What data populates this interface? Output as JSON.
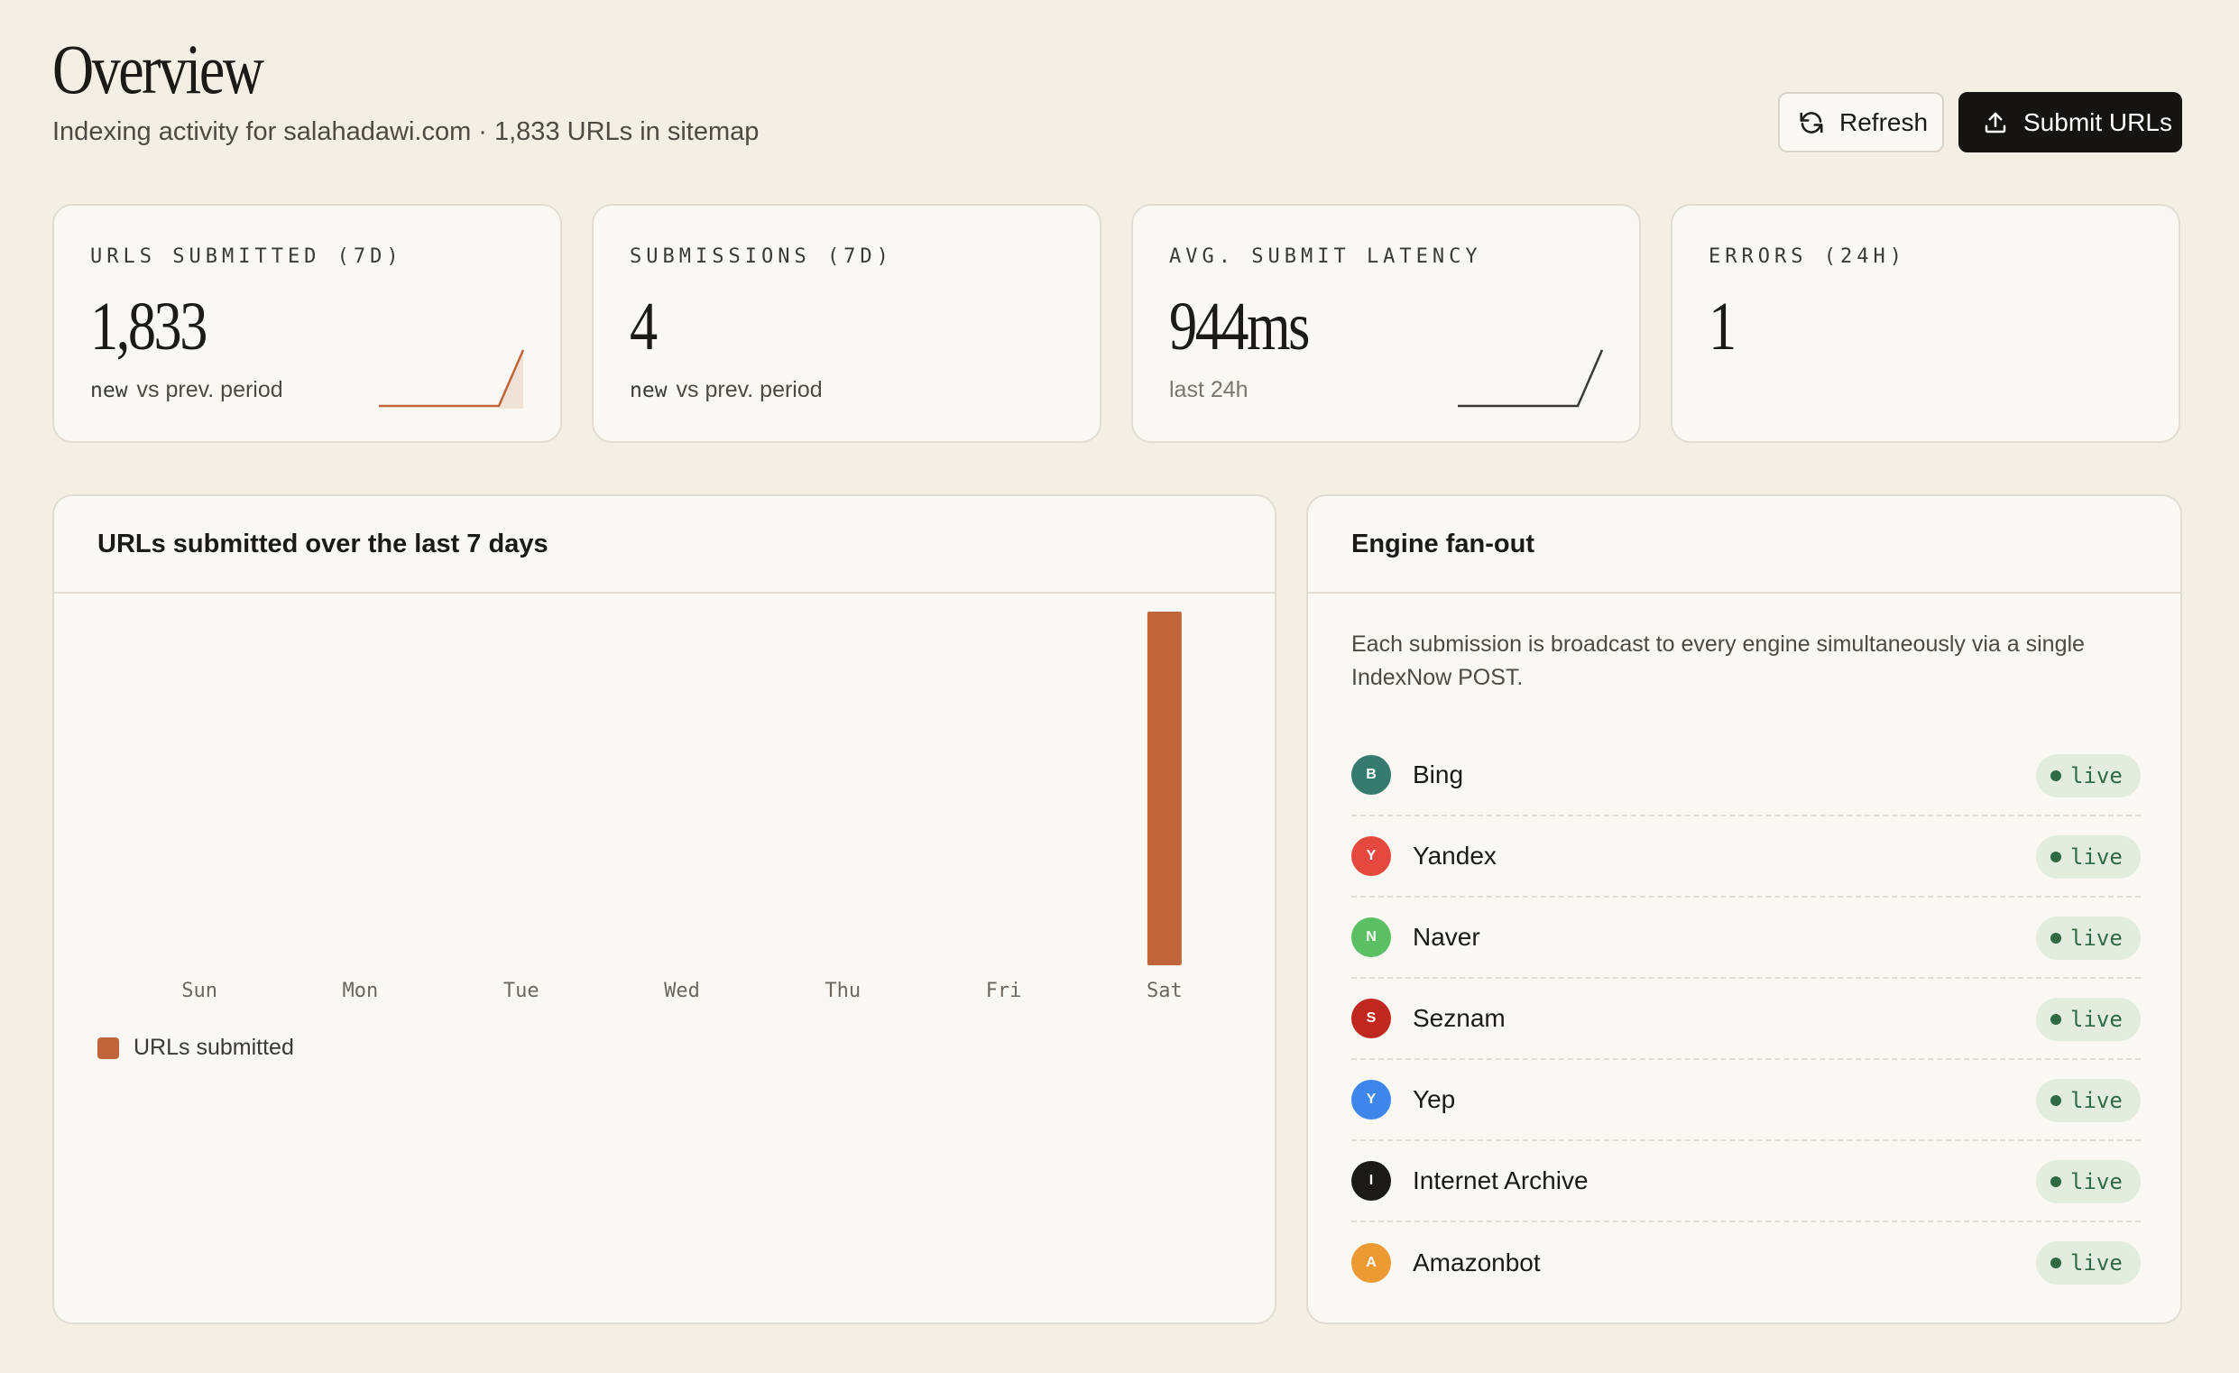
{
  "header": {
    "title": "Overview",
    "subtitle": "Indexing activity for salahadawi.com · 1,833 URLs in sitemap",
    "refresh_label": "Refresh",
    "submit_label": "Submit URLs"
  },
  "stats": [
    {
      "label": "URLS SUBMITTED (7D)",
      "value": "1,833",
      "sub_mono": "new",
      "sub": "vs prev. period",
      "spark_color": "#c0643a"
    },
    {
      "label": "SUBMISSIONS (7D)",
      "value": "4",
      "sub_mono": "new",
      "sub": "vs prev. period"
    },
    {
      "label": "AVG. SUBMIT LATENCY",
      "value": "944ms",
      "sub": "last 24h",
      "spark_color": "#3c3934"
    },
    {
      "label": "ERRORS (24H)",
      "value": "1"
    }
  ],
  "chart_panel": {
    "title": "URLs submitted over the last 7 days",
    "legend_label": "URLs submitted"
  },
  "chart_data": {
    "type": "bar",
    "categories": [
      "Sun",
      "Mon",
      "Tue",
      "Wed",
      "Thu",
      "Fri",
      "Sat"
    ],
    "series": [
      {
        "name": "URLs submitted",
        "values": [
          0,
          0,
          0,
          0,
          0,
          0,
          1833
        ]
      }
    ],
    "color": "#c0643a",
    "grid": false,
    "legend_position": "bottom-left"
  },
  "engines_panel": {
    "title": "Engine fan-out",
    "description": "Each submission is broadcast to every engine simultaneously via a single IndexNow POST.",
    "status_label": "live",
    "engines": [
      {
        "name": "Bing",
        "initial": "B",
        "color": "#357a6f"
      },
      {
        "name": "Yandex",
        "initial": "Y",
        "color": "#e5483f"
      },
      {
        "name": "Naver",
        "initial": "N",
        "color": "#5bbf63"
      },
      {
        "name": "Seznam",
        "initial": "S",
        "color": "#c0281f"
      },
      {
        "name": "Yep",
        "initial": "Y",
        "color": "#3f86ec"
      },
      {
        "name": "Internet Archive",
        "initial": "I",
        "color": "#1c1a17"
      },
      {
        "name": "Amazonbot",
        "initial": "A",
        "color": "#ee9a33"
      }
    ]
  }
}
